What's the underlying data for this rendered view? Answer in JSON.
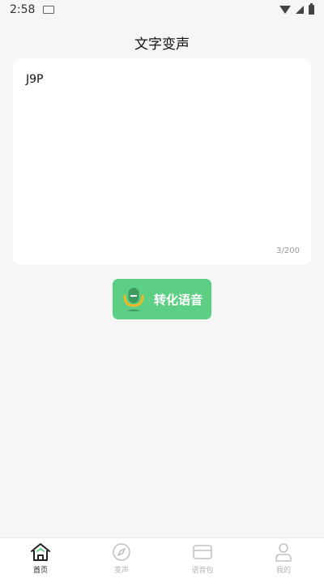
{
  "status_bar": {
    "time": "2:58"
  },
  "header": {
    "title": "文字变声"
  },
  "editor": {
    "text": "J9P",
    "counter": "3/200"
  },
  "convert": {
    "label": "转化语音"
  },
  "nav": {
    "items": [
      {
        "label": "首页",
        "icon": "home-icon",
        "active": true
      },
      {
        "label": "变声",
        "icon": "compass-icon",
        "active": false
      },
      {
        "label": "语音包",
        "icon": "card-icon",
        "active": false
      },
      {
        "label": "我的",
        "icon": "user-icon",
        "active": false
      }
    ]
  },
  "colors": {
    "accent": "#5ccf85",
    "background": "#f6f6f6",
    "inactive": "#b5b5b5"
  }
}
